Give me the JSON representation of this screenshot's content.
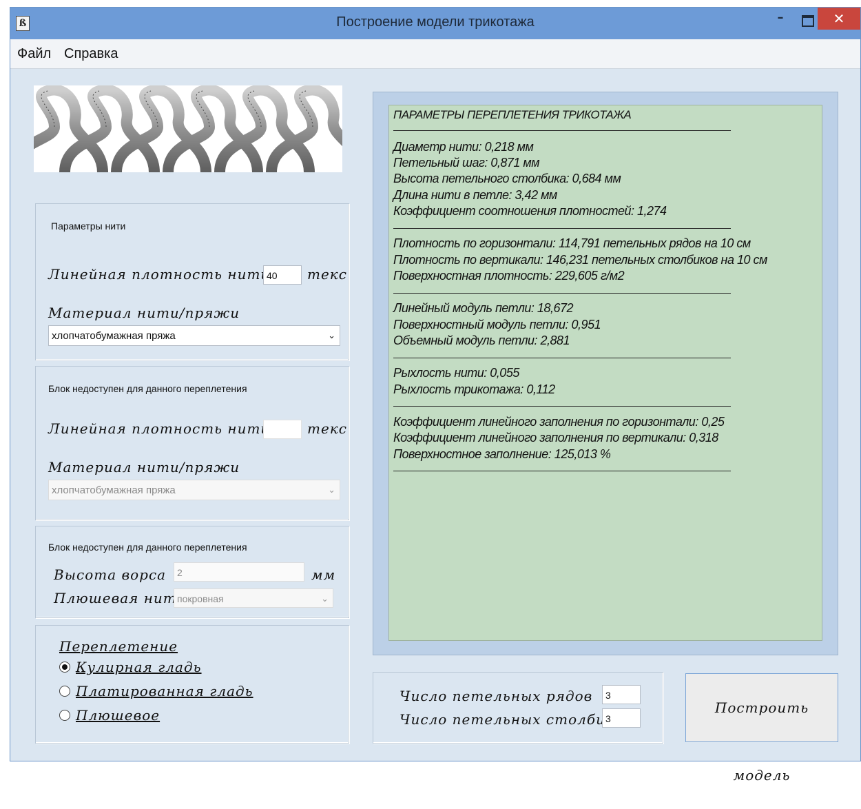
{
  "window": {
    "title": "Построение модели трикотажа",
    "minimize_glyph": "–",
    "close_glyph": "✕",
    "app_icon_glyph": "ß"
  },
  "menu": {
    "items": [
      "Файл",
      "Справка"
    ]
  },
  "yarn_params": {
    "heading": "Параметры нити",
    "density_label": "Линейная плотность нити",
    "density_value": "40",
    "unit": "текс",
    "material_label": "Материал нити/пряжи",
    "material_selected": "хлопчатобумажная пряжа"
  },
  "disabled_block1": {
    "heading": "Блок недоступен для данного переплетения",
    "density_label": "Линейная плотность нити",
    "density_value": "",
    "unit": "текс",
    "material_label": "Материал нити/пряжи",
    "material_selected": "хлопчатобумажная пряжа"
  },
  "disabled_block2": {
    "heading": "Блок недоступен для данного переплетения",
    "pile_height_label": "Высота ворса",
    "pile_height_value": "2",
    "pile_unit": "мм",
    "plush_thread_label": "Плюшевая нить",
    "plush_thread_selected": "покровная"
  },
  "weave": {
    "heading": "Переплетение",
    "options": [
      {
        "label": "Кулирная гладь",
        "checked": true
      },
      {
        "label": "Платированная гладь",
        "checked": false
      },
      {
        "label": "Плюшевое",
        "checked": false
      }
    ]
  },
  "output": {
    "title": "ПАРАМЕТРЫ ПЕРЕПЛЕТЕНИЯ ТРИКОТАЖА",
    "lines": [
      "Диаметр нити: 0,218 мм",
      "Петельный шаг: 0,871 мм",
      "Высота петельного столбика: 0,684 мм",
      "Длина нити в петле: 3,42 мм",
      "Коэффициент соотношения плотностей: 1,274",
      "Плотность по горизонтали: 114,791 петельных рядов на 10 см",
      "Плотность по вертикали: 146,231 петельных столбиков на 10 см",
      "Поверхностная плотность: 229,605 г/м2",
      "Линейный модуль петли: 18,672",
      "Поверхностный модуль петли: 0,951",
      "Объемный модуль петли: 2,881",
      "Рыхлость нити: 0,055",
      "Рыхлость трикотажа: 0,112",
      "Коэффициент линейного заполнения по горизонтали: 0,25",
      "Коэффициент линейного заполнения по вертикали: 0,318",
      "Поверхностное заполнение: 125,013 %"
    ]
  },
  "counts": {
    "rows_label": "Число петельных рядов",
    "rows_value": "3",
    "cols_label": "Число петельных столбиков",
    "cols_value": "3"
  },
  "build_button_label": "Построить модель",
  "icons": {
    "select_chevron": "⌄"
  }
}
